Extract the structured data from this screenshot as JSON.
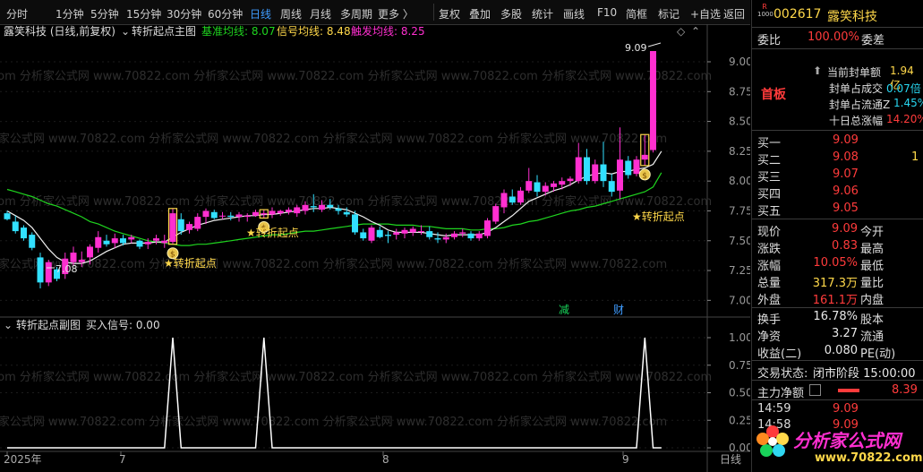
{
  "toolbar": {
    "periods": [
      "分时",
      "1分钟",
      "5分钟",
      "15分钟",
      "30分钟",
      "60分钟",
      "日线",
      "周线",
      "月线",
      "多周期",
      "更多 〉"
    ],
    "active_period": "日线",
    "tools": [
      "复权",
      "叠加",
      "多股",
      "统计",
      "画线",
      "F10",
      "简框",
      "标记",
      "+自选",
      "返回"
    ]
  },
  "main_chart": {
    "stock_title": "露笑科技 (日线,前复权)",
    "indicator_name": "转折起点主图",
    "base_ma_label": "基准均线: 8.07",
    "signal_ma_label": "信号均线: 8.48",
    "trigger_ma_label": "触发均线: 8.25",
    "high_marker": "9.09",
    "low_marker": "7.08",
    "signal_labels": [
      "★转折起点",
      "★转折起点",
      "★转折起点"
    ],
    "event_tags": [
      "减",
      "财"
    ],
    "watermark": "com 分析家公式网 www.70822.com 分析家公式网 www.70822.com 分析家公式网 www.70822.com 分析家公式网 www.70822.com",
    "colors": {
      "up": "#ff2fd0",
      "down": "#32e0ff",
      "base_ma": "#1fd51f",
      "signal_ma": "#f2f2f2",
      "label": "#ffd84a"
    }
  },
  "sub_chart": {
    "indicator_name": "转折起点副图",
    "buy_signal_label": "买入信号: 0.00",
    "watermark": "com 分析家公式网 www.70822.com 分析家公式网 www.70822.com 分析家公式网 www.70822.com 分析家公式网 www.70822.com"
  },
  "time_axis": {
    "labels": [
      "2025年",
      "7",
      "8",
      "9"
    ],
    "right_label": "日线"
  },
  "quote": {
    "code": "002617",
    "name": "露笑科技",
    "weibi_label": "委比",
    "weibi_value": "100.00%",
    "weicha_label": "委差",
    "seal_lines": [
      {
        "label": "当前封单额",
        "value": "1.94亿"
      },
      {
        "label": "封单占成交",
        "value": "0.07倍"
      },
      {
        "label": "封单占流通Z",
        "value": "1.45%"
      },
      {
        "label": "十日总涨幅",
        "value": "14.20%"
      }
    ],
    "board_label": "首板",
    "bids": [
      {
        "label": "买一",
        "price": "9.09",
        "vol": ""
      },
      {
        "label": "买二",
        "price": "9.08",
        "vol": "1"
      },
      {
        "label": "买三",
        "price": "9.07",
        "vol": ""
      },
      {
        "label": "买四",
        "price": "9.06",
        "vol": ""
      },
      {
        "label": "买五",
        "price": "9.05",
        "vol": ""
      }
    ],
    "stats": [
      {
        "l1": "现价",
        "v1": "9.09",
        "l2": "今开",
        "v2": ""
      },
      {
        "l1": "涨跌",
        "v1": "0.83",
        "l2": "最高",
        "v2": ""
      },
      {
        "l1": "涨幅",
        "v1": "10.05%",
        "l2": "最低",
        "v2": ""
      },
      {
        "l1": "总量",
        "v1": "317.3万",
        "l2": "量比",
        "v2": ""
      },
      {
        "l1": "外盘",
        "v1": "161.1万",
        "l2": "内盘",
        "v2": ""
      },
      {
        "l1": "换手",
        "v1": "16.78%",
        "l2": "股本",
        "v2": ""
      },
      {
        "l1": "净资",
        "v1": "3.27",
        "l2": "流通",
        "v2": ""
      },
      {
        "l1": "收益(二)",
        "v1": "0.080",
        "l2": "PE(动)",
        "v2": ""
      }
    ],
    "trade_status_label": "交易状态:",
    "trade_status_value": "闭市阶段 15:00:00",
    "main_net_label": "主力净额",
    "main_net_value": "8.39",
    "ticks": [
      {
        "time": "14:59",
        "price": "9.09"
      },
      {
        "time": "14:58",
        "price": "9.09"
      }
    ],
    "logo_text": "分析家公式网",
    "logo_url": "www.70822.com"
  },
  "chart_data": [
    {
      "type": "candlestick",
      "title": "转折起点主图",
      "ylim": [
        6.95,
        9.12
      ],
      "yticks": [
        7.0,
        7.25,
        7.5,
        7.75,
        8.0,
        8.25,
        8.5,
        8.75,
        9.0
      ],
      "candles": [
        {
          "o": 7.73,
          "h": 7.75,
          "l": 7.67,
          "c": 7.68
        },
        {
          "o": 7.66,
          "h": 7.71,
          "l": 7.56,
          "c": 7.58
        },
        {
          "o": 7.61,
          "h": 7.63,
          "l": 7.5,
          "c": 7.52
        },
        {
          "o": 7.55,
          "h": 7.57,
          "l": 7.42,
          "c": 7.44
        },
        {
          "o": 7.36,
          "h": 7.4,
          "l": 7.1,
          "c": 7.15
        },
        {
          "o": 7.15,
          "h": 7.34,
          "l": 7.12,
          "c": 7.32
        },
        {
          "o": 7.26,
          "h": 7.28,
          "l": 7.16,
          "c": 7.18
        },
        {
          "o": 7.22,
          "h": 7.4,
          "l": 7.18,
          "c": 7.35
        },
        {
          "o": 7.32,
          "h": 7.45,
          "l": 7.29,
          "c": 7.4
        },
        {
          "o": 7.32,
          "h": 7.41,
          "l": 7.28,
          "c": 7.34
        },
        {
          "o": 7.36,
          "h": 7.47,
          "l": 7.3,
          "c": 7.45
        },
        {
          "o": 7.44,
          "h": 7.58,
          "l": 7.4,
          "c": 7.53
        },
        {
          "o": 7.5,
          "h": 7.55,
          "l": 7.45,
          "c": 7.47
        },
        {
          "o": 7.48,
          "h": 7.56,
          "l": 7.44,
          "c": 7.52
        },
        {
          "o": 7.52,
          "h": 7.55,
          "l": 7.46,
          "c": 7.48
        },
        {
          "o": 7.51,
          "h": 7.55,
          "l": 7.48,
          "c": 7.53
        },
        {
          "o": 7.5,
          "h": 7.51,
          "l": 7.43,
          "c": 7.45
        },
        {
          "o": 7.47,
          "h": 7.52,
          "l": 7.43,
          "c": 7.49
        },
        {
          "o": 7.5,
          "h": 7.55,
          "l": 7.47,
          "c": 7.52
        },
        {
          "o": 7.48,
          "h": 7.55,
          "l": 7.44,
          "c": 7.5
        },
        {
          "o": 7.49,
          "h": 7.77,
          "l": 7.47,
          "c": 7.73
        },
        {
          "o": 7.68,
          "h": 7.73,
          "l": 7.55,
          "c": 7.58
        },
        {
          "o": 7.59,
          "h": 7.66,
          "l": 7.56,
          "c": 7.64
        },
        {
          "o": 7.6,
          "h": 7.73,
          "l": 7.58,
          "c": 7.7
        },
        {
          "o": 7.7,
          "h": 7.77,
          "l": 7.64,
          "c": 7.75
        },
        {
          "o": 7.74,
          "h": 7.76,
          "l": 7.68,
          "c": 7.69
        },
        {
          "o": 7.71,
          "h": 7.74,
          "l": 7.68,
          "c": 7.71
        },
        {
          "o": 7.71,
          "h": 7.74,
          "l": 7.67,
          "c": 7.7
        },
        {
          "o": 7.7,
          "h": 7.74,
          "l": 7.66,
          "c": 7.72
        },
        {
          "o": 7.7,
          "h": 7.73,
          "l": 7.66,
          "c": 7.71
        },
        {
          "o": 7.71,
          "h": 7.76,
          "l": 7.7,
          "c": 7.74
        },
        {
          "o": 7.72,
          "h": 7.76,
          "l": 7.69,
          "c": 7.73
        },
        {
          "o": 7.72,
          "h": 7.78,
          "l": 7.69,
          "c": 7.75
        },
        {
          "o": 7.73,
          "h": 7.76,
          "l": 7.71,
          "c": 7.75
        },
        {
          "o": 7.74,
          "h": 7.78,
          "l": 7.72,
          "c": 7.76
        },
        {
          "o": 7.73,
          "h": 7.8,
          "l": 7.7,
          "c": 7.78
        },
        {
          "o": 7.75,
          "h": 7.83,
          "l": 7.72,
          "c": 7.8
        },
        {
          "o": 7.79,
          "h": 7.89,
          "l": 7.74,
          "c": 7.78
        },
        {
          "o": 7.76,
          "h": 7.84,
          "l": 7.74,
          "c": 7.8
        },
        {
          "o": 7.8,
          "h": 7.85,
          "l": 7.76,
          "c": 7.78
        },
        {
          "o": 7.77,
          "h": 7.8,
          "l": 7.72,
          "c": 7.75
        },
        {
          "o": 7.74,
          "h": 7.78,
          "l": 7.7,
          "c": 7.72
        },
        {
          "o": 7.72,
          "h": 7.75,
          "l": 7.55,
          "c": 7.57
        },
        {
          "o": 7.57,
          "h": 7.6,
          "l": 7.5,
          "c": 7.52
        },
        {
          "o": 7.5,
          "h": 7.63,
          "l": 7.48,
          "c": 7.61
        },
        {
          "o": 7.59,
          "h": 7.62,
          "l": 7.52,
          "c": 7.53
        },
        {
          "o": 7.55,
          "h": 7.58,
          "l": 7.48,
          "c": 7.54
        },
        {
          "o": 7.55,
          "h": 7.6,
          "l": 7.51,
          "c": 7.57
        },
        {
          "o": 7.56,
          "h": 7.61,
          "l": 7.52,
          "c": 7.59
        },
        {
          "o": 7.57,
          "h": 7.62,
          "l": 7.54,
          "c": 7.6
        },
        {
          "o": 7.58,
          "h": 7.63,
          "l": 7.55,
          "c": 7.58
        },
        {
          "o": 7.58,
          "h": 7.62,
          "l": 7.51,
          "c": 7.53
        },
        {
          "o": 7.52,
          "h": 7.57,
          "l": 7.48,
          "c": 7.51
        },
        {
          "o": 7.51,
          "h": 7.56,
          "l": 7.48,
          "c": 7.53
        },
        {
          "o": 7.53,
          "h": 7.58,
          "l": 7.51,
          "c": 7.56
        },
        {
          "o": 7.56,
          "h": 7.6,
          "l": 7.53,
          "c": 7.57
        },
        {
          "o": 7.56,
          "h": 7.58,
          "l": 7.5,
          "c": 7.52
        },
        {
          "o": 7.52,
          "h": 7.58,
          "l": 7.5,
          "c": 7.56
        },
        {
          "o": 7.54,
          "h": 7.69,
          "l": 7.52,
          "c": 7.67
        },
        {
          "o": 7.66,
          "h": 7.81,
          "l": 7.64,
          "c": 7.79
        },
        {
          "o": 7.78,
          "h": 7.93,
          "l": 7.73,
          "c": 7.9
        },
        {
          "o": 7.87,
          "h": 7.93,
          "l": 7.8,
          "c": 7.82
        },
        {
          "o": 7.82,
          "h": 7.95,
          "l": 7.8,
          "c": 7.92
        },
        {
          "o": 7.92,
          "h": 8.11,
          "l": 7.9,
          "c": 8.0
        },
        {
          "o": 7.99,
          "h": 8.05,
          "l": 7.87,
          "c": 7.91
        },
        {
          "o": 7.91,
          "h": 7.99,
          "l": 7.88,
          "c": 7.96
        },
        {
          "o": 7.95,
          "h": 8.0,
          "l": 7.91,
          "c": 7.98
        },
        {
          "o": 7.97,
          "h": 8.03,
          "l": 7.93,
          "c": 8.0
        },
        {
          "o": 8.0,
          "h": 8.04,
          "l": 7.96,
          "c": 8.02
        },
        {
          "o": 8.0,
          "h": 8.32,
          "l": 7.98,
          "c": 8.2
        },
        {
          "o": 8.2,
          "h": 8.27,
          "l": 7.97,
          "c": 8.0
        },
        {
          "o": 8.0,
          "h": 8.18,
          "l": 7.98,
          "c": 8.14
        },
        {
          "o": 8.14,
          "h": 8.33,
          "l": 7.95,
          "c": 8.0
        },
        {
          "o": 8.0,
          "h": 8.06,
          "l": 7.87,
          "c": 7.91
        },
        {
          "o": 7.92,
          "h": 8.45,
          "l": 7.85,
          "c": 8.18
        },
        {
          "o": 8.17,
          "h": 8.21,
          "l": 8.02,
          "c": 8.05
        },
        {
          "o": 8.06,
          "h": 8.21,
          "l": 8.04,
          "c": 8.18
        },
        {
          "o": 8.18,
          "h": 8.39,
          "l": 8.13,
          "c": 8.22
        },
        {
          "o": 8.26,
          "h": 9.09,
          "l": 8.24,
          "c": 9.09
        }
      ],
      "series": [
        {
          "name": "基准均线",
          "values": [
            7.93,
            7.91,
            7.89,
            7.87,
            7.84,
            7.81,
            7.79,
            7.76,
            7.73,
            7.7,
            7.66,
            7.64,
            7.61,
            7.58,
            7.56,
            7.54,
            7.52,
            7.5,
            7.49,
            7.48,
            7.47,
            7.46,
            7.46,
            7.47,
            7.47,
            7.48,
            7.49,
            7.5,
            7.51,
            7.52,
            7.53,
            7.54,
            7.55,
            7.55,
            7.56,
            7.57,
            7.58,
            7.58,
            7.59,
            7.6,
            7.61,
            7.62,
            7.63,
            7.64,
            7.64,
            7.64,
            7.64,
            7.63,
            7.63,
            7.63,
            7.62,
            7.62,
            7.61,
            7.6,
            7.6,
            7.6,
            7.59,
            7.59,
            7.6,
            7.6,
            7.61,
            7.63,
            7.64,
            7.66,
            7.67,
            7.69,
            7.71,
            7.73,
            7.75,
            7.76,
            7.78,
            7.79,
            7.81,
            7.83,
            7.85,
            7.87,
            7.89,
            7.91,
            7.95,
            8.07
          ]
        },
        {
          "name": "信号均线",
          "values": [
            7.75,
            7.71,
            7.67,
            7.61,
            7.52,
            7.43,
            7.36,
            7.32,
            7.31,
            7.31,
            7.33,
            7.37,
            7.41,
            7.44,
            7.47,
            7.48,
            7.48,
            7.48,
            7.49,
            7.49,
            7.53,
            7.57,
            7.6,
            7.63,
            7.65,
            7.67,
            7.68,
            7.69,
            7.7,
            7.71,
            7.71,
            7.72,
            7.72,
            7.73,
            7.74,
            7.75,
            7.76,
            7.77,
            7.77,
            7.78,
            7.77,
            7.76,
            7.73,
            7.7,
            7.66,
            7.63,
            7.59,
            7.57,
            7.57,
            7.57,
            7.57,
            7.56,
            7.55,
            7.54,
            7.55,
            7.55,
            7.55,
            7.55,
            7.57,
            7.61,
            7.66,
            7.71,
            7.77,
            7.83,
            7.86,
            7.89,
            7.92,
            7.94,
            7.97,
            8.01,
            8.04,
            8.06,
            8.07,
            8.06,
            8.08,
            8.08,
            8.1,
            8.11,
            8.14,
            8.25
          ]
        }
      ],
      "signals_at_index": [
        20,
        31,
        77
      ],
      "annotations": {
        "high": 9.09,
        "low": 7.08
      }
    },
    {
      "type": "line",
      "title": "转折起点副图",
      "ylim": [
        0,
        1
      ],
      "yticks": [
        0.0,
        0.25,
        0.5,
        0.75,
        1.0
      ],
      "values": [
        0,
        0,
        0,
        0,
        0,
        0,
        0,
        0,
        0,
        0,
        0,
        0,
        0,
        0,
        0,
        0,
        0,
        0,
        0,
        0,
        1,
        0,
        0,
        0,
        0,
        0,
        0,
        0,
        0,
        0,
        0,
        1,
        0,
        0,
        0,
        0,
        0,
        0,
        0,
        0,
        0,
        0,
        0,
        0,
        0,
        0,
        0,
        0,
        0,
        0,
        0,
        0,
        0,
        0,
        0,
        0,
        0,
        0,
        0,
        0,
        0,
        0,
        0,
        0,
        0,
        0,
        0,
        0,
        0,
        0,
        0,
        0,
        0,
        0,
        0,
        0,
        0,
        1,
        0,
        0
      ]
    }
  ]
}
